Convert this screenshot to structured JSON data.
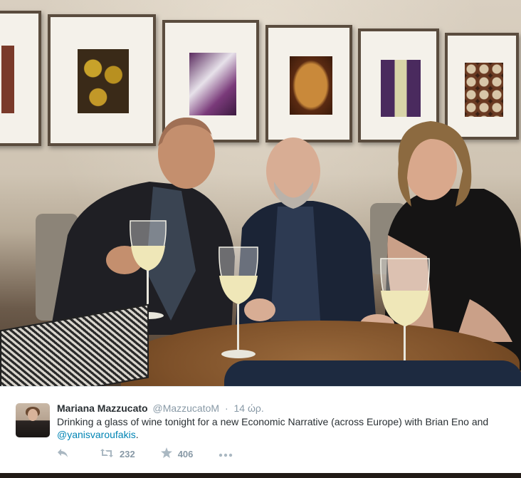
{
  "photo": {
    "alt_icon": "photo-image",
    "colors": {
      "wall": "#d4c9b8",
      "table": "#7d5029"
    }
  },
  "tweet": {
    "author_name": "Mariana Mazzucato",
    "author_handle": "@MazzucatoM",
    "separator": "·",
    "timestamp": "14 ώρ.",
    "text_main": "Drinking a glass of wine tonight for a new Economic Narrative (across Europe) with Brian Eno and ",
    "text_mention": "@yanisvaroufakis",
    "text_end": ".",
    "actions": {
      "reply_icon": "reply-icon",
      "retweet_icon": "retweet-icon",
      "retweet_count": "232",
      "favorite_icon": "star-icon",
      "favorite_count": "406",
      "more_icon": "more-icon"
    },
    "colors": {
      "link": "#0084b4",
      "text": "#292f33",
      "muted": "#8899a6"
    }
  }
}
